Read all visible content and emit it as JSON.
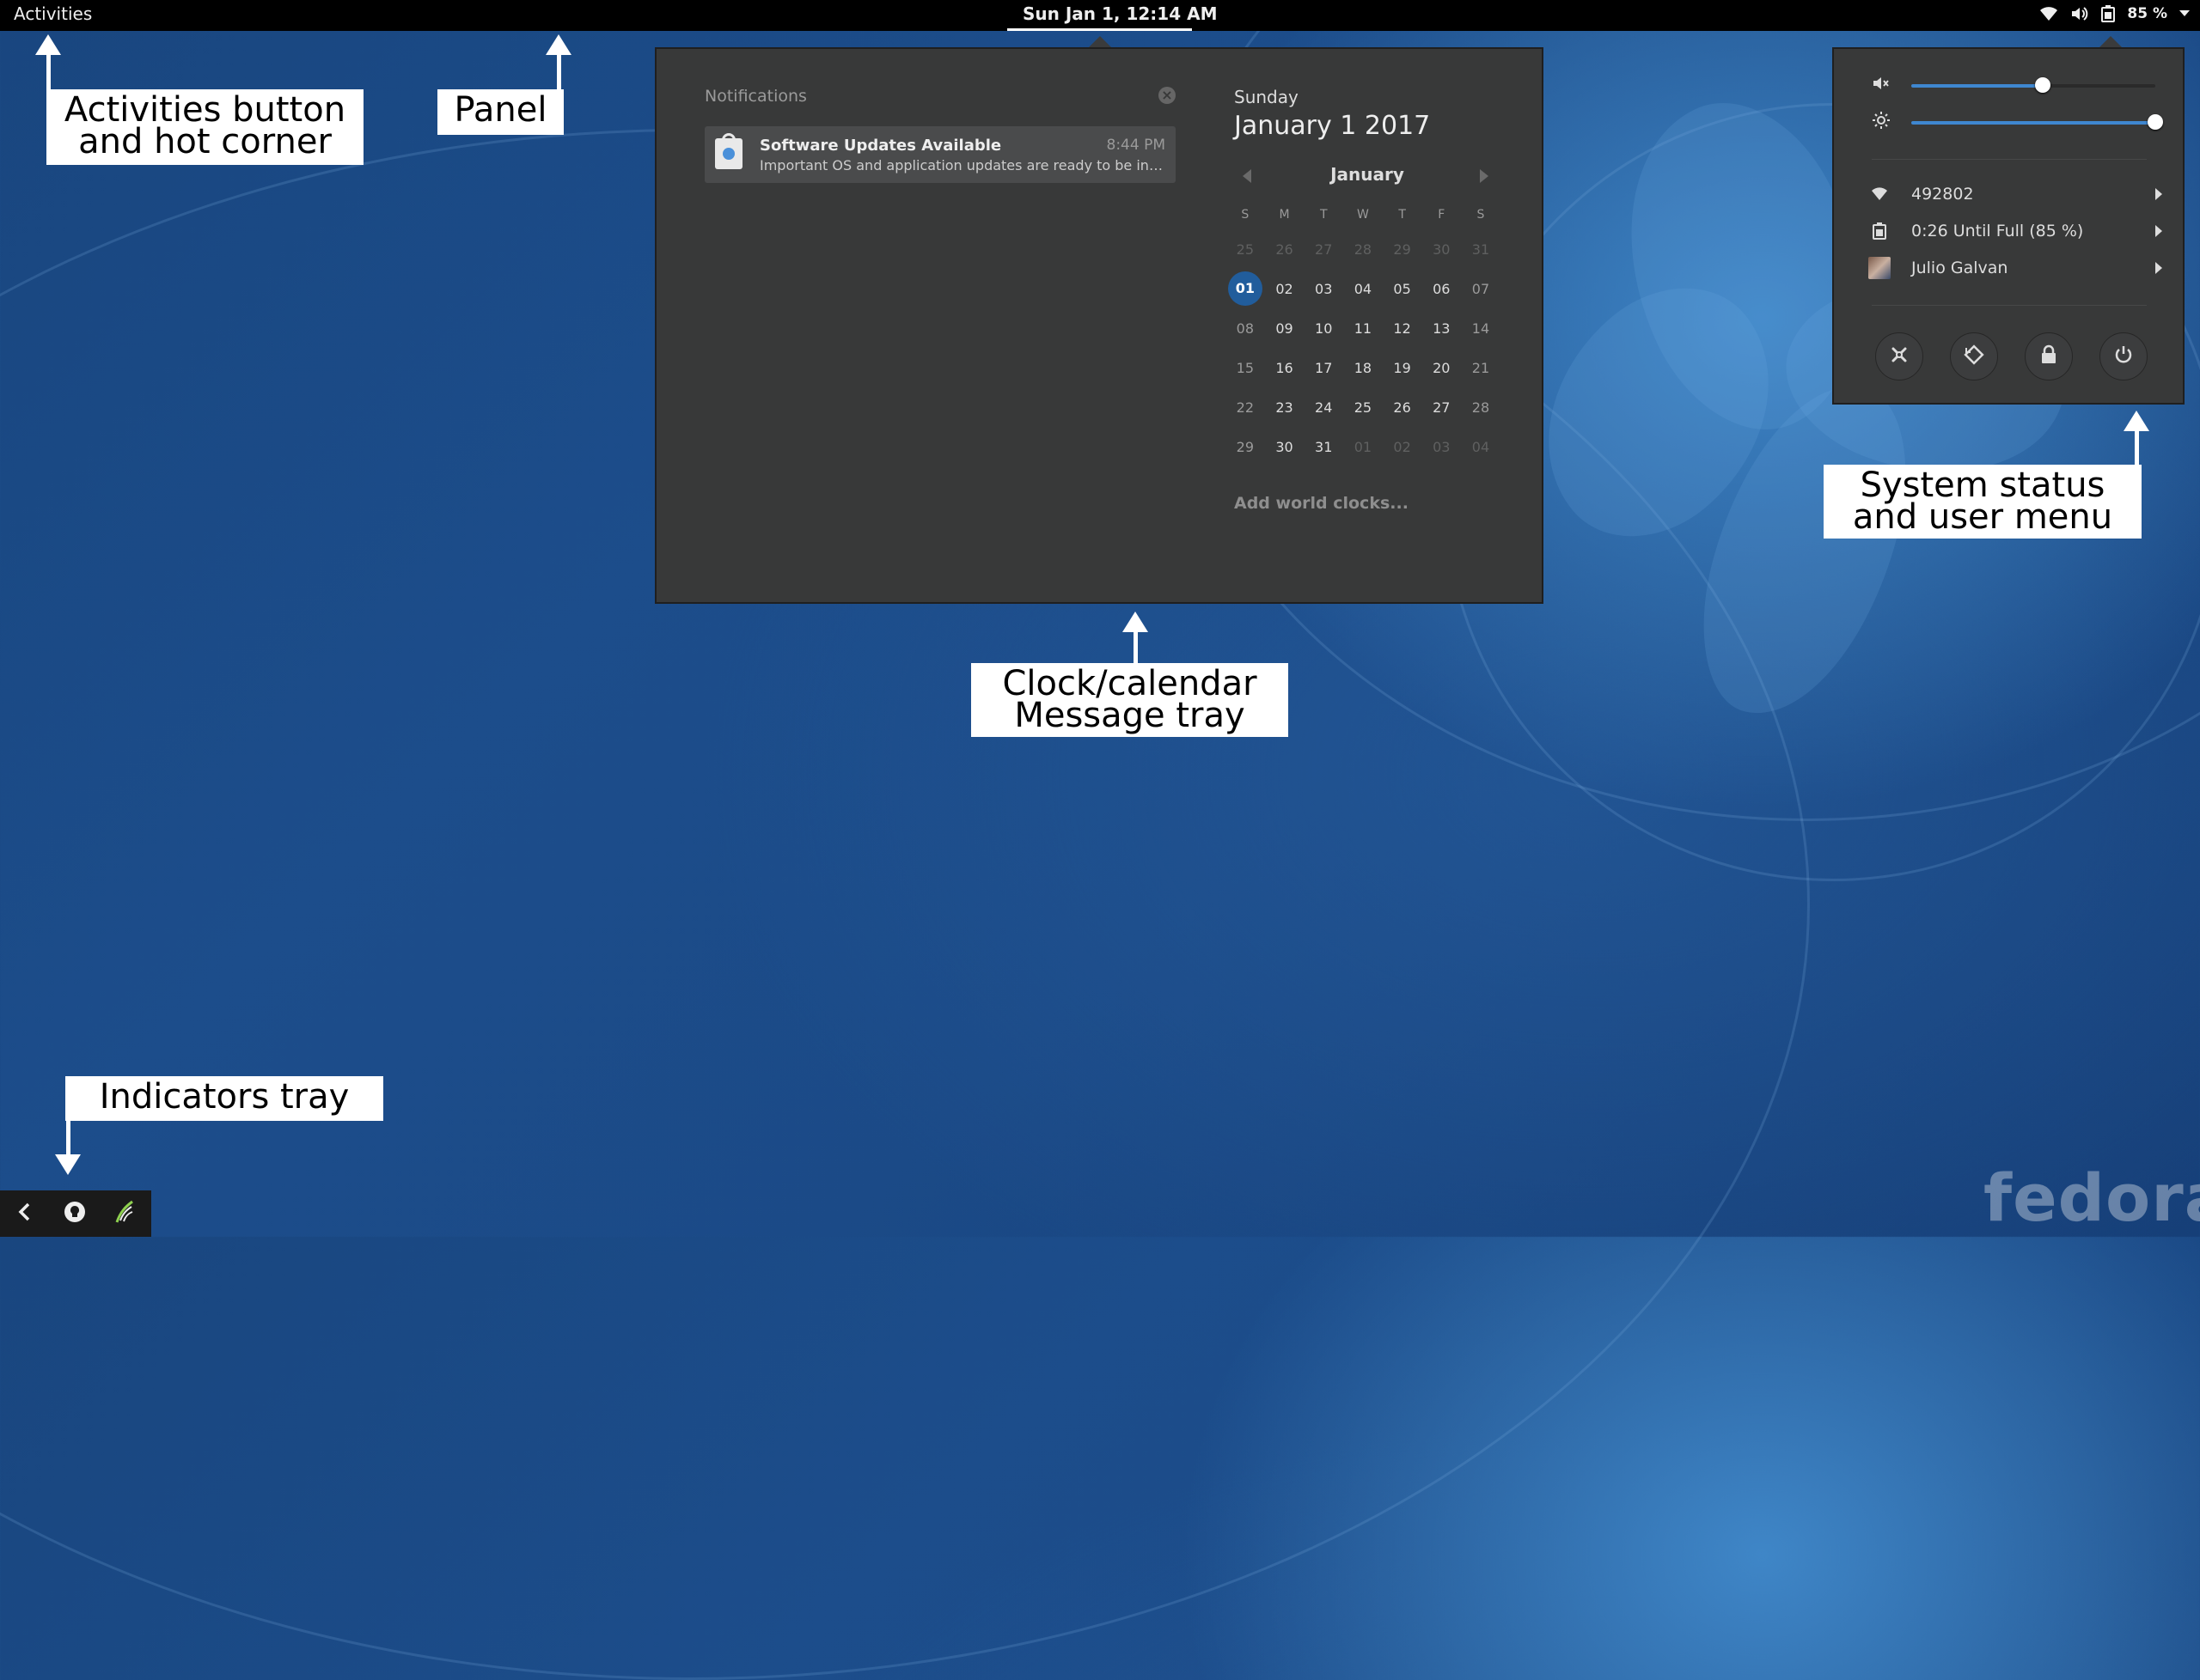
{
  "panel": {
    "activities_label": "Activities",
    "clock_label": "Sun Jan  1, 12:14 AM",
    "battery_percent_label": "85 %",
    "icons": [
      "wifi-icon",
      "volume-icon",
      "battery-icon",
      "dropdown-icon"
    ]
  },
  "notifications": {
    "header": "Notifications",
    "items": [
      {
        "title": "Software Updates Available",
        "time": "8:44 PM",
        "body": "Important OS and application updates are ready to be install..."
      }
    ]
  },
  "calendar": {
    "weekday": "Sunday",
    "date": "January  1 2017",
    "month": "January",
    "dow": [
      "S",
      "M",
      "T",
      "W",
      "T",
      "F",
      "S"
    ],
    "weeks": [
      [
        "25",
        "26",
        "27",
        "28",
        "29",
        "30",
        "31"
      ],
      [
        "01",
        "02",
        "03",
        "04",
        "05",
        "06",
        "07"
      ],
      [
        "08",
        "09",
        "10",
        "11",
        "12",
        "13",
        "14"
      ],
      [
        "15",
        "16",
        "17",
        "18",
        "19",
        "20",
        "21"
      ],
      [
        "22",
        "23",
        "24",
        "25",
        "26",
        "27",
        "28"
      ],
      [
        "29",
        "30",
        "31",
        "01",
        "02",
        "03",
        "04"
      ]
    ],
    "today": "01",
    "world_clocks_label": "Add world clocks..."
  },
  "system_menu": {
    "volume_level": 0.54,
    "brightness_level": 1.0,
    "wifi_label": "492802",
    "battery_label": "0:26 Until Full (85 %)",
    "user_label": "Julio Galvan",
    "buttons": [
      "settings-icon",
      "rotation-lock-icon",
      "lock-icon",
      "power-icon"
    ]
  },
  "annotations": {
    "activities": "Activities button and hot corner",
    "activities_line1": "Activities button",
    "activities_line2": "and hot corner",
    "panel": "Panel",
    "clock_line1": "Clock/calendar",
    "clock_line2": "Message tray",
    "system_line1": "System status",
    "system_line2": "and user menu",
    "indicators": "Indicators tray"
  },
  "tray": {
    "icons": [
      "back-arrow-icon",
      "lightbulb-icon",
      "shell-script-icon"
    ]
  },
  "branding": {
    "logo_text": "fedora"
  },
  "colors": {
    "accent": "#215d9c",
    "slider_fill": "#3f87d0",
    "popover_bg": "#383939",
    "panel_bg": "#000000"
  }
}
